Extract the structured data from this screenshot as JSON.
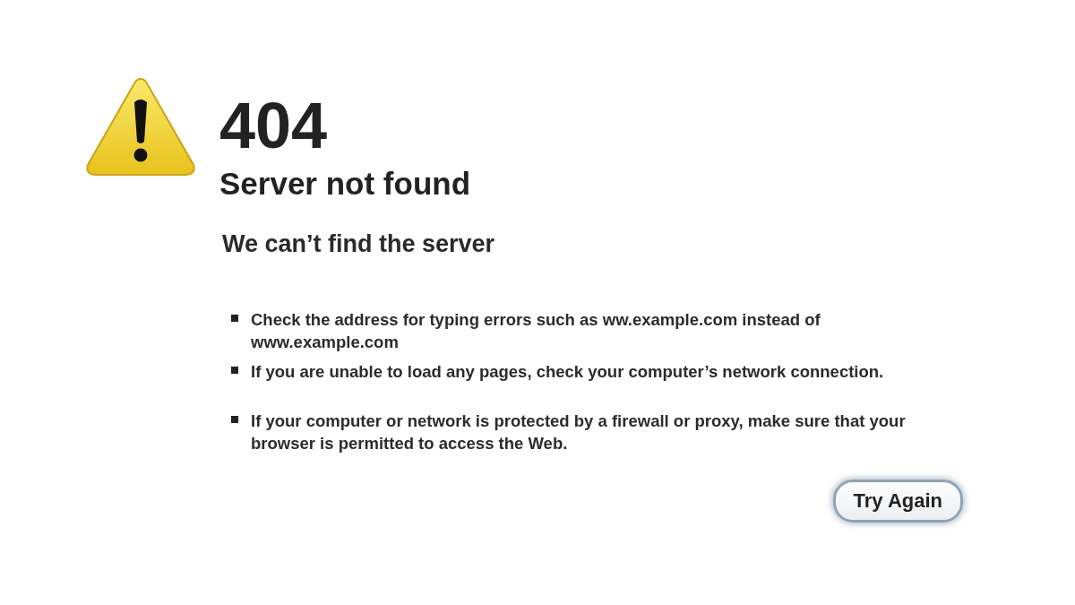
{
  "error": {
    "code": "404",
    "title": "Server not found"
  },
  "heading": "We can’t find the server",
  "suggestions": [
    "Check the address for typing errors such as ww.example.com instead of www.example.com",
    "If you are unable to load any pages, check your computer’s network connection.",
    "If your computer or network is protected by a firewall or proxy, make sure that your browser is permitted to access the Web."
  ],
  "button": "Try Again"
}
